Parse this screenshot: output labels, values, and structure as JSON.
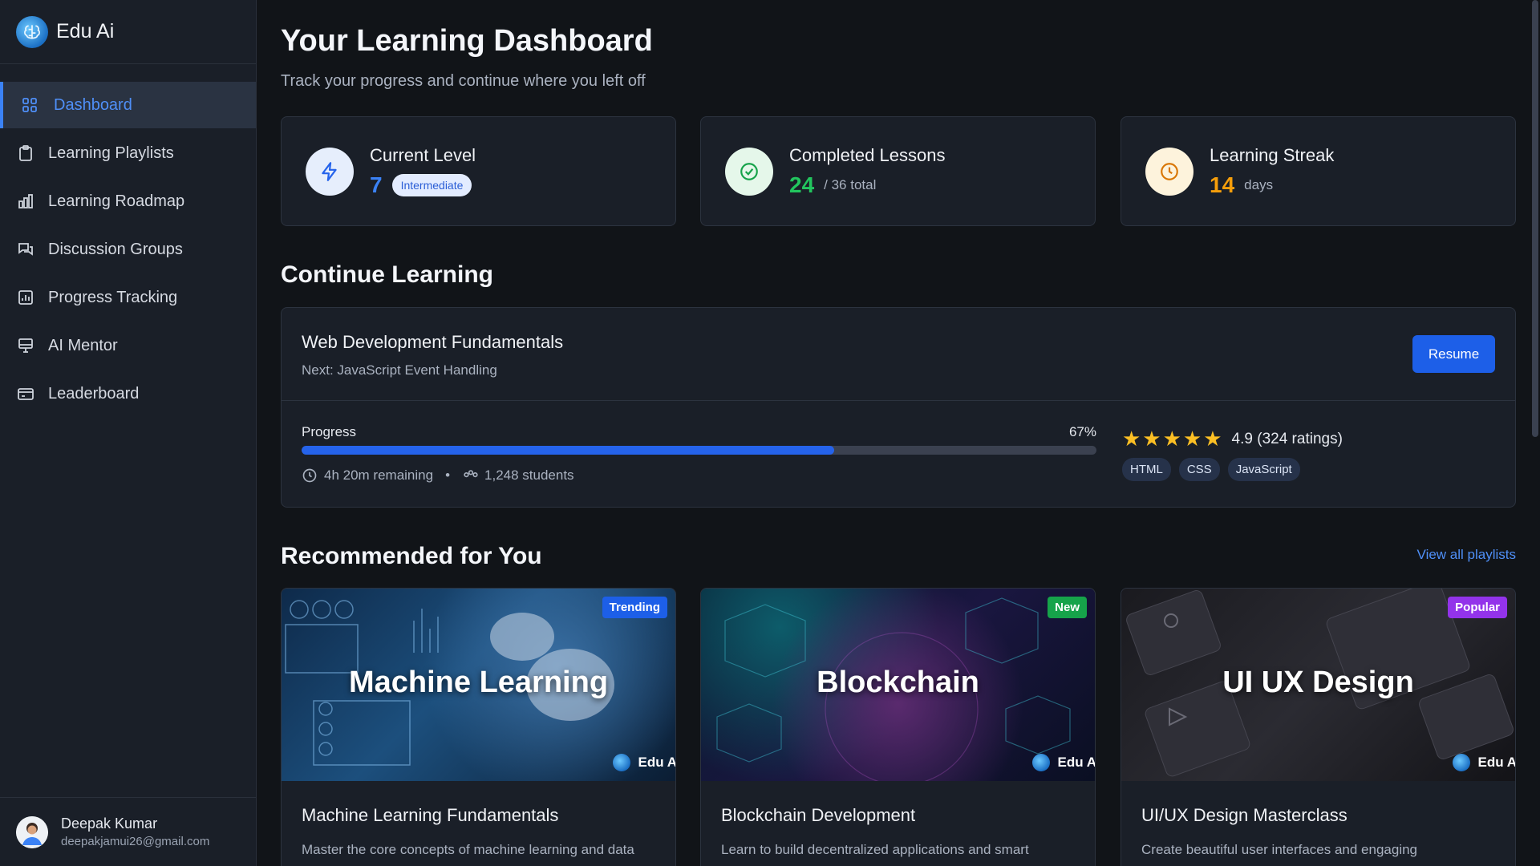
{
  "brand": {
    "name": "Edu Ai",
    "logo_icon": "brain-icon"
  },
  "sidebar": {
    "items": [
      {
        "label": "Dashboard",
        "icon": "grid-icon",
        "active": true
      },
      {
        "label": "Learning Playlists",
        "icon": "clipboard-icon",
        "active": false
      },
      {
        "label": "Learning Roadmap",
        "icon": "bar-chart-icon",
        "active": false
      },
      {
        "label": "Discussion Groups",
        "icon": "chat-icon",
        "active": false
      },
      {
        "label": "Progress Tracking",
        "icon": "chart-icon",
        "active": false
      },
      {
        "label": "AI Mentor",
        "icon": "monitor-icon",
        "active": false
      },
      {
        "label": "Leaderboard",
        "icon": "card-icon",
        "active": false
      }
    ]
  },
  "user": {
    "name": "Deepak Kumar",
    "email": "deepakjamui26@gmail.com"
  },
  "header": {
    "title": "Your Learning Dashboard",
    "subtitle": "Track your progress and continue where you left off"
  },
  "stats": {
    "level": {
      "title": "Current Level",
      "value": "7",
      "badge": "Intermediate",
      "color": "#3b82f6"
    },
    "lessons": {
      "title": "Completed Lessons",
      "value": "24",
      "unit": "/ 36 total",
      "color": "#22c55e"
    },
    "streak": {
      "title": "Learning Streak",
      "value": "14",
      "unit": "days",
      "color": "#f59e0b"
    }
  },
  "continue": {
    "section_title": "Continue Learning",
    "course_title": "Web Development Fundamentals",
    "next": "Next: JavaScript Event Handling",
    "resume_label": "Resume",
    "progress_label": "Progress",
    "progress_text": "67%",
    "progress_fraction": 0.67,
    "remaining": "4h 20m remaining",
    "separator": "•",
    "students": "1,248 students",
    "stars": "★★★★★",
    "rating_text": "4.9 (324 ratings)",
    "tags": [
      "HTML",
      "CSS",
      "JavaScript"
    ]
  },
  "recommended": {
    "section_title": "Recommended for You",
    "view_all": "View all playlists",
    "cards": [
      {
        "image_title": "Machine Learning",
        "badge": "Trending",
        "badge_color": "#1d5fe8",
        "watermark": "Edu A",
        "title": "Machine Learning Fundamentals",
        "desc": "Master the core concepts of machine learning and data"
      },
      {
        "image_title": "Blockchain",
        "badge": "New",
        "badge_color": "#16a34a",
        "watermark": "Edu A",
        "title": "Blockchain Development",
        "desc": "Learn to build decentralized applications and smart"
      },
      {
        "image_title": "UI UX Design",
        "badge": "Popular",
        "badge_color": "#9333ea",
        "watermark": "Edu A",
        "title": "UI/UX Design Masterclass",
        "desc": "Create beautiful user interfaces and engaging"
      }
    ]
  }
}
